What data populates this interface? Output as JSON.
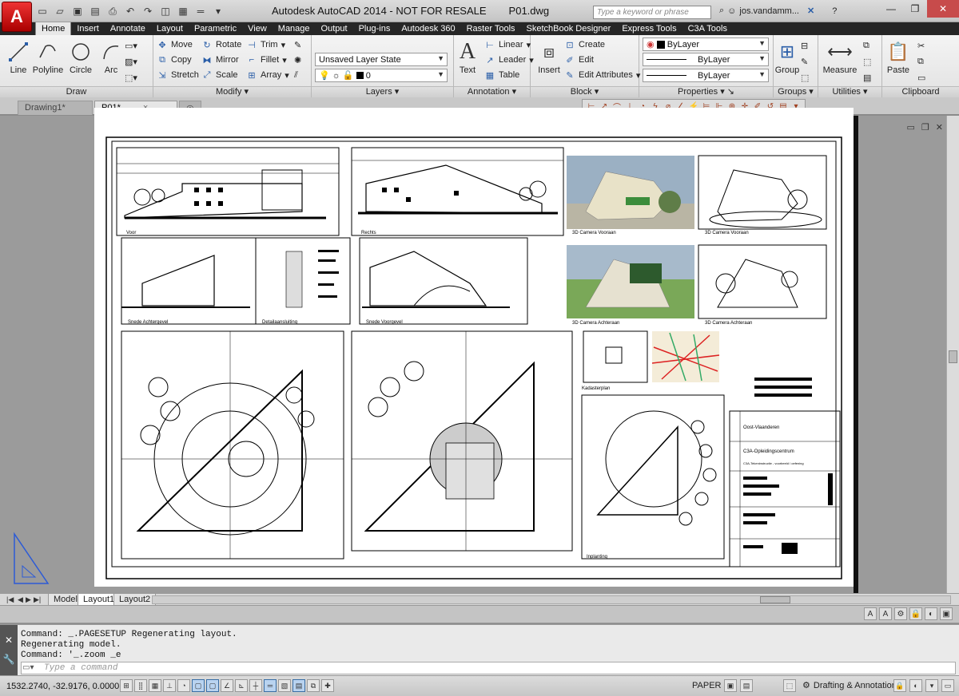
{
  "app": {
    "title": "Autodesk AutoCAD 2014 - NOT FOR RESALE",
    "filename": "P01.dwg",
    "logo_letter": "A",
    "search_placeholder": "Type a keyword or phrase",
    "username": "jos.vandamm...",
    "window_buttons": [
      "minimize",
      "restore",
      "close"
    ]
  },
  "ribbon": {
    "tabs": [
      "Home",
      "Insert",
      "Annotate",
      "Layout",
      "Parametric",
      "View",
      "Manage",
      "Output",
      "Plug-ins",
      "Autodesk 360",
      "Raster Tools",
      "SketchBook Designer",
      "Express Tools",
      "C3A Tools"
    ],
    "active_tab": "Home",
    "draw": {
      "title": "Draw",
      "line": "Line",
      "polyline": "Polyline",
      "circle": "Circle",
      "arc": "Arc"
    },
    "modify": {
      "title": "Modify",
      "move": "Move",
      "rotate": "Rotate",
      "trim": "Trim",
      "copy": "Copy",
      "mirror": "Mirror",
      "fillet": "Fillet",
      "stretch": "Stretch",
      "scale": "Scale",
      "array": "Array"
    },
    "layers": {
      "title": "Layers",
      "layer_state": "Unsaved Layer State",
      "current_layer": "0"
    },
    "annotation": {
      "title": "Annotation",
      "text": "Text",
      "linear": "Linear",
      "leader": "Leader",
      "table": "Table"
    },
    "block": {
      "title": "Block",
      "insert": "Insert",
      "create": "Create",
      "edit": "Edit",
      "edit_attributes": "Edit Attributes"
    },
    "properties": {
      "title": "Properties",
      "color": "ByLayer",
      "linetype": "ByLayer",
      "lineweight": "ByLayer"
    },
    "groups": {
      "title": "Groups",
      "group": "Group"
    },
    "utilities": {
      "title": "Utilities",
      "measure": "Measure"
    },
    "clipboard": {
      "title": "Clipboard",
      "paste": "Paste"
    }
  },
  "doc_tabs": [
    {
      "label": "Drawing1*"
    },
    {
      "label": "P01*"
    }
  ],
  "active_doc": "P01*",
  "sheet": {
    "views": [
      "Voor",
      "Rechts",
      "3D Camera Vooraan",
      "3D Camera Vooraan",
      "Snede Achtergevel",
      "Detailaansluiting",
      "Snede Voorgevel",
      "3D Camera Achteraan",
      "3D Camera Achteraan",
      "Kadasterplan",
      "Inplanting"
    ],
    "title_block": {
      "province": "Oost-Vlaanderen",
      "school": "C3A-Opleidingscentrum",
      "subtitle": "C3A-Tekeninstructie - voorbeeld / oefening",
      "street_label": "Inplanting"
    }
  },
  "layout_tabs": [
    "Model",
    "Layout1",
    "Layout2"
  ],
  "active_layout": "Layout1",
  "command": {
    "history": [
      "Command: _.PAGESETUP Regenerating layout.",
      "Regenerating model.",
      "Command: '_.zoom _e"
    ],
    "placeholder": "Type a command"
  },
  "status": {
    "coords": "1532.2740, -32.9176, 0.0000",
    "space": "PAPER",
    "workspace": "Drafting & Annotation"
  },
  "colors": {
    "accent": "#b80000",
    "ribbon_tab_bg": "#262626",
    "drawing_bg": "#9b9b9b"
  }
}
